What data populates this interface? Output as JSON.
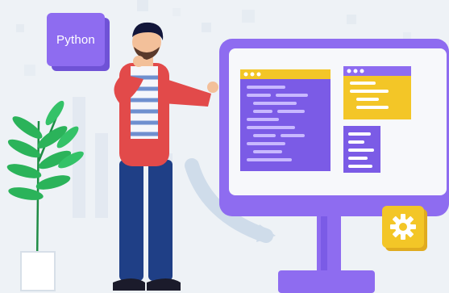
{
  "badge": {
    "label": "Python"
  },
  "colors": {
    "purple": "#8e6cf0",
    "purple_dark": "#6f52d6",
    "yellow": "#f3c627",
    "red_shirt": "#e24a4a",
    "navy_pants": "#1f3f86",
    "leaf_green": "#2bb35a",
    "background": "#eef2f6"
  },
  "icons": {
    "gear": "gear-icon",
    "plant": "plant-icon"
  }
}
